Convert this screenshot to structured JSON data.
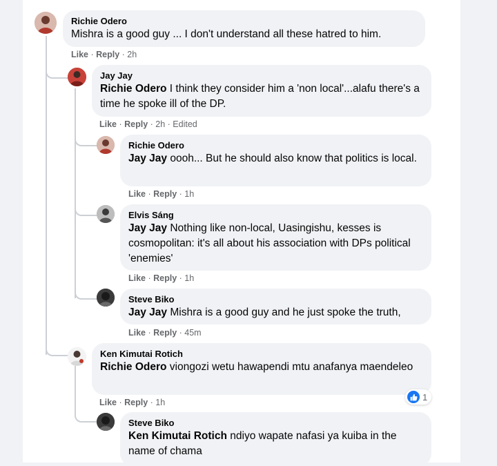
{
  "comments": [
    {
      "author": "Richie Odero",
      "mention": "",
      "text": "Mishra is a good guy ... I don't understand all these hatred to him.",
      "like": "Like",
      "reply": "Reply",
      "meta": " · 2h"
    },
    {
      "author": "Jay Jay",
      "mention": "Richie Odero",
      "text": " I think they consider him a 'non local'...alafu there's a time he spoke ill of the DP.",
      "like": "Like",
      "reply": "Reply",
      "meta": " · 2h · Edited"
    },
    {
      "author": "Richie Odero",
      "mention": "Jay Jay",
      "text": " oooh... But he should also know that politics is local.",
      "like": "Like",
      "reply": "Reply",
      "meta": " · 1h"
    },
    {
      "author": "Elvis Sáng",
      "mention": "Jay Jay",
      "text": " Nothing like non-local, Uasingishu, kesses is cosmopolitan: it's all about his association with DPs political 'enemies'",
      "like": "Like",
      "reply": "Reply",
      "meta": " · 1h"
    },
    {
      "author": "Steve Biko",
      "mention": "Jay Jay",
      "text": " Mishra is a good guy and he just spoke the truth,",
      "like": "Like",
      "reply": "Reply",
      "meta": " · 45m"
    },
    {
      "author": "Ken Kimutai Rotich",
      "mention": "Richie Odero",
      "text": " viongozi wetu hawapendi mtu anafanya maendeleo",
      "like": "Like",
      "reply": "Reply",
      "meta": " · 1h",
      "reaction_count": "1"
    },
    {
      "author": "Steve Biko",
      "mention": "Ken Kimutai Rotich",
      "text": " ndiyo wapate nafasi ya kuiba in the name of chama",
      "like": "",
      "reply": "",
      "meta": ""
    }
  ],
  "colors": {
    "bubble": "#f0f2f5",
    "meta": "#65676b",
    "like_blue": "#1877f2"
  }
}
